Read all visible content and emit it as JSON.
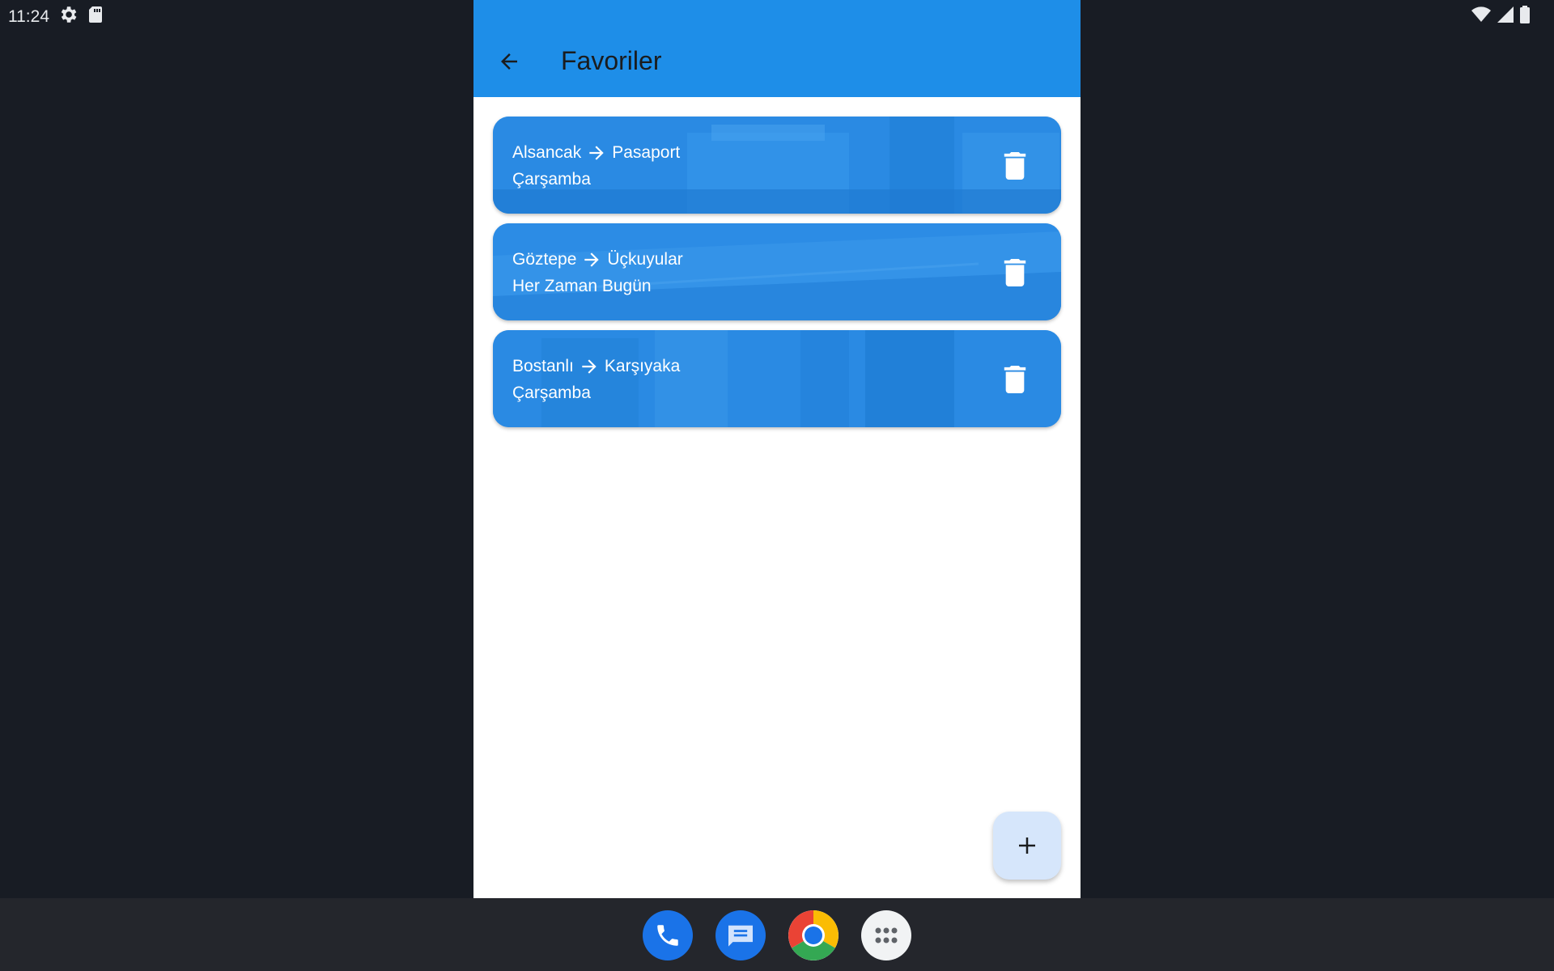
{
  "status_bar": {
    "time": "11:24",
    "left_icons": [
      "settings-icon",
      "sd-card-icon"
    ],
    "right_icons": [
      "wifi-icon",
      "signal-icon",
      "battery-icon"
    ]
  },
  "app_bar": {
    "title": "Favoriler",
    "back_icon": "arrow-back-icon",
    "color": "#1e8ee8"
  },
  "favorites": [
    {
      "from": "Alsancak",
      "to": "Pasaport",
      "day": "Çarşamba",
      "arrow_icon": "arrow-right-icon",
      "delete_icon": "trash-icon"
    },
    {
      "from": "Göztepe",
      "to": "Üçkuyular",
      "day": "Her Zaman Bugün",
      "arrow_icon": "arrow-right-icon",
      "delete_icon": "trash-icon"
    },
    {
      "from": "Bostanlı",
      "to": "Karşıyaka",
      "day": "Çarşamba",
      "arrow_icon": "arrow-right-icon",
      "delete_icon": "trash-icon"
    }
  ],
  "fab": {
    "icon": "plus-icon",
    "color": "#d6e6fb"
  },
  "taskbar": {
    "apps": [
      "phone-icon",
      "messages-icon",
      "chrome-icon",
      "app-drawer-icon"
    ]
  }
}
